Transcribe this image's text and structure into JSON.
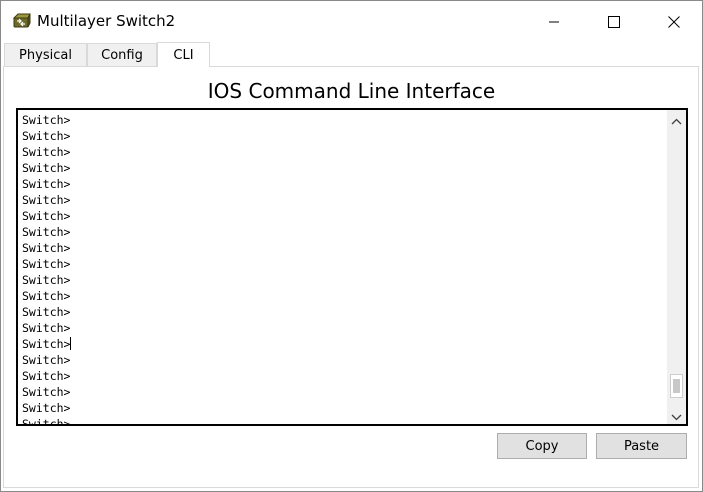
{
  "window": {
    "title": "Multilayer Switch2",
    "icon": "multilayer-switch-icon",
    "controls": {
      "minimize_icon": "minimize-icon",
      "maximize_icon": "maximize-icon",
      "close_icon": "close-icon"
    }
  },
  "tabs": [
    {
      "label": "Physical",
      "active": false
    },
    {
      "label": "Config",
      "active": false
    },
    {
      "label": "CLI",
      "active": true
    }
  ],
  "cli": {
    "heading": "IOS Command Line Interface",
    "lines": [
      "Switch>",
      "Switch>",
      "Switch>",
      "Switch>",
      "Switch>",
      "Switch>",
      "Switch>",
      "Switch>",
      "Switch>",
      "Switch>",
      "Switch>",
      "Switch>",
      "Switch>",
      "Switch>",
      "Switch>",
      "Switch>",
      "Switch>",
      "Switch>",
      "Switch>",
      "Switch>"
    ],
    "cursor_line_index": 14
  },
  "buttons": {
    "copy": "Copy",
    "paste": "Paste"
  },
  "colors": {
    "tab_inactive": "#f0f0f0",
    "button_bg": "#e1e1e1",
    "terminal_border": "#000000"
  }
}
